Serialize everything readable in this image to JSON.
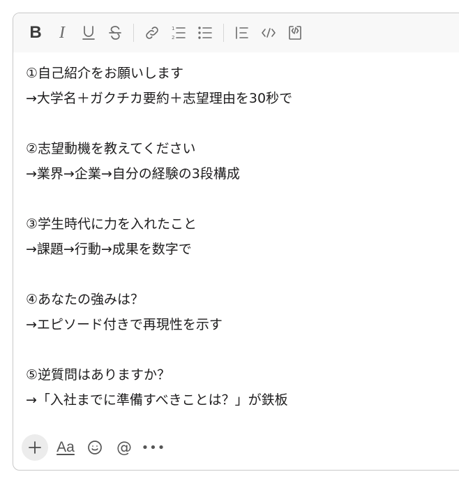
{
  "toolbar": {
    "bold": "B",
    "italic": "I",
    "buttons": [
      {
        "name": "bold"
      },
      {
        "name": "italic"
      },
      {
        "name": "underline"
      },
      {
        "name": "strikethrough"
      },
      {
        "name": "link"
      },
      {
        "name": "ordered-list"
      },
      {
        "name": "bulleted-list"
      },
      {
        "name": "blockquote"
      },
      {
        "name": "code"
      },
      {
        "name": "code-block"
      }
    ]
  },
  "message": {
    "lines": [
      "①自己紹介をお願いします",
      "→大学名＋ガクチカ要約＋志望理由を30秒で",
      "",
      "②志望動機を教えてください",
      "→業界→企業→自分の経験の3段構成",
      "",
      "③学生時代に力を入れたこと",
      "→課題→行動→成果を数字で",
      "",
      "④あなたの強みは？",
      "→エピソード付きで再現性を示す",
      "",
      "⑤逆質問はありますか？",
      "→「入社までに準備すべきことは？」が鉄板"
    ]
  },
  "footer": {
    "plus": "+",
    "format_label": "Aa",
    "mention": "@",
    "more": "•••"
  }
}
